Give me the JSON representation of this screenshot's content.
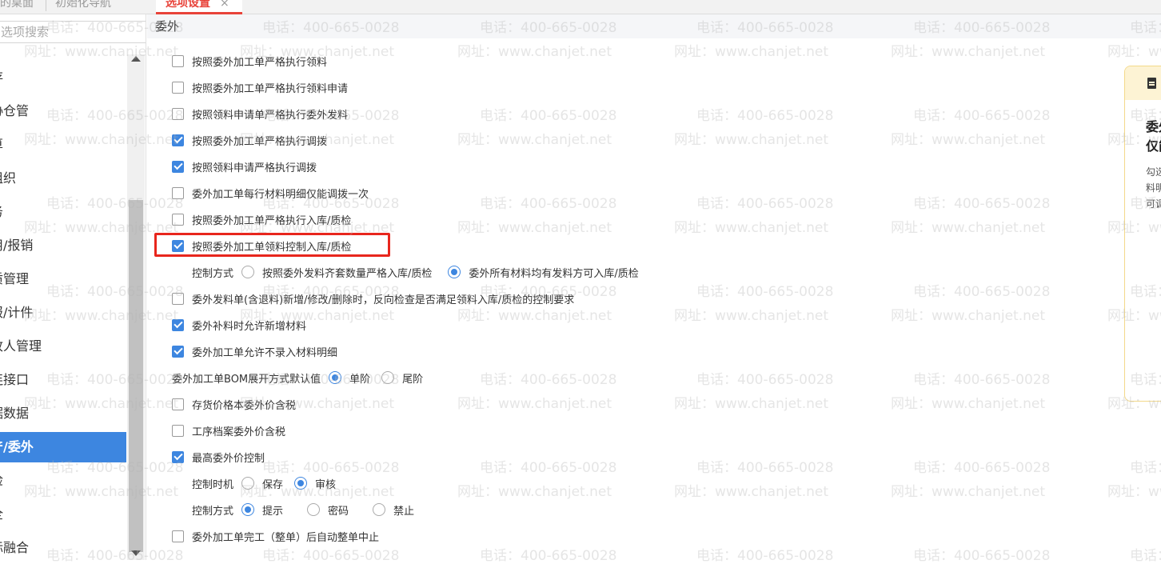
{
  "tabs": [
    {
      "label": "的桌面"
    },
    {
      "label": "初始化导航"
    },
    {
      "label": "选项设置",
      "close": "×"
    }
  ],
  "sidebar": {
    "search_placeholder": "选项搜索",
    "items": [
      "存",
      "协仓管",
      "算",
      "组织",
      "务",
      "用/报销",
      "质管理",
      "报/计件",
      "收人管理",
      "连接口",
      "据数据",
      "产/委外",
      "检",
      "全",
      "标融合"
    ],
    "active_index": 11
  },
  "section": {
    "title": "委外"
  },
  "options": {
    "o1": "按照委外加工单严格执行领料",
    "o2": "按照委外加工单严格执行领料申请",
    "o3": "按照领料申请单严格执行委外发料",
    "o4": "按照委外加工单严格执行调拨",
    "o5": "按照领料申请严格执行调拨",
    "o6": "委外加工单每行材料明细仅能调拨一次",
    "o7": "按照委外加工单严格执行入库/质检",
    "o8": "按照委外加工单领料控制入库/质检",
    "o8_mode_label": "控制方式",
    "o8_mode_a": "按照委外发料齐套数量严格入库/质检",
    "o8_mode_b": "委外所有材料均有发料方可入库/质检",
    "o9": "委外发料单(含退料)新增/修改/删除时，反向检查是否满足领料入库/质检的控制要求",
    "o10": "委外补料时允许新增材料",
    "o11": "委外加工单允许不录入材料明细",
    "bom_label": "委外加工单BOM展开方式默认值",
    "bom_a": "单阶",
    "bom_b": "尾阶",
    "o12": "存货价格本委外价含税",
    "o13": "工序档案委外价含税",
    "o14": "最高委外价控制",
    "o14_time_label": "控制时机",
    "o14_time_a": "保存",
    "o14_time_b": "审核",
    "o14_mode_label": "控制方式",
    "o14_mode_a": "提示",
    "o14_mode_b": "密码",
    "o14_mode_c": "禁止",
    "o15": "委外加工单完工（整单）后自动整单中止"
  },
  "side_card": {
    "title": "委外\n仅能",
    "text": "勾选\n料明\n可调"
  },
  "watermark": {
    "phone": "电话：400-665-0028",
    "site": "网址：www.chanjet.net"
  },
  "colors": {
    "accent": "#3d86e0",
    "highlight": "#e8261d",
    "active_tab": "#e8433a"
  }
}
